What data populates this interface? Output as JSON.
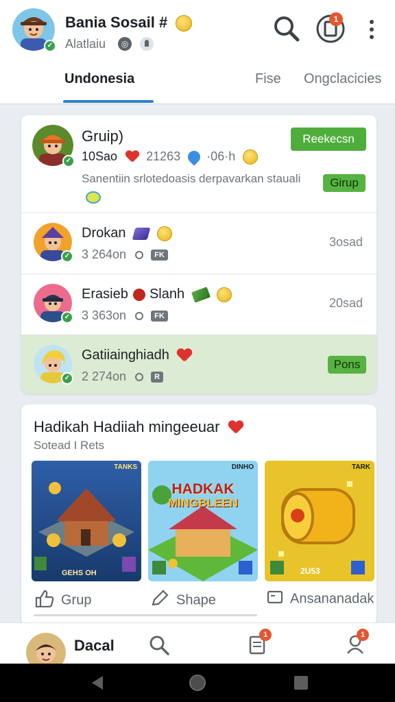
{
  "header": {
    "profile_name": "Bania Sosail",
    "profile_name_suffix": "#",
    "profile_sub": "Alatlaiu",
    "notification_count": "1"
  },
  "tabs": [
    {
      "label": "Undonesia",
      "active": true
    },
    {
      "label": "Fise",
      "active": false
    },
    {
      "label": "Ongclacicies",
      "active": false
    }
  ],
  "feed": {
    "group": {
      "name": "Gruip)",
      "stats_a": "10Sao",
      "stats_b": "21263",
      "stats_c": "·06·h",
      "description": "Sanentiin srlotedoasis derpavarkan stauali",
      "button": "Reekecsn",
      "tag": "Girup"
    },
    "rows": [
      {
        "name": "Drokan",
        "meta": "3 264on",
        "pill": "FK",
        "time": "3osad"
      },
      {
        "name": "Erasieb",
        "name2": "Slanh",
        "meta": "3 363on",
        "pill": "FK",
        "time": "20sad"
      },
      {
        "name": "Gatiiainghiadh",
        "meta": "2 274on",
        "pill": "R",
        "tag": "Pons"
      }
    ]
  },
  "reward": {
    "title": "Hadikah Hadiiah mingeeuar",
    "subtitle": "Sotead I Rets",
    "tiles": [
      {
        "top_label": "TANKS",
        "bottom_label": "GEHS OH"
      },
      {
        "banner_line1": "HADKAK",
        "banner_line2": "MINGBLEEN",
        "top_label": "DINHO"
      },
      {
        "top_label": "TARK",
        "bottom_label": "2U53"
      }
    ],
    "actions": {
      "like": "Grup",
      "share": "Shape",
      "announce": "Ansananadak"
    }
  },
  "bottom": {
    "name": "Dacal",
    "badge_docs": "1",
    "badge_people": "1"
  },
  "colors": {
    "accent": "#2d7fd0",
    "green": "#4fae3b",
    "badge": "#e6562f"
  }
}
